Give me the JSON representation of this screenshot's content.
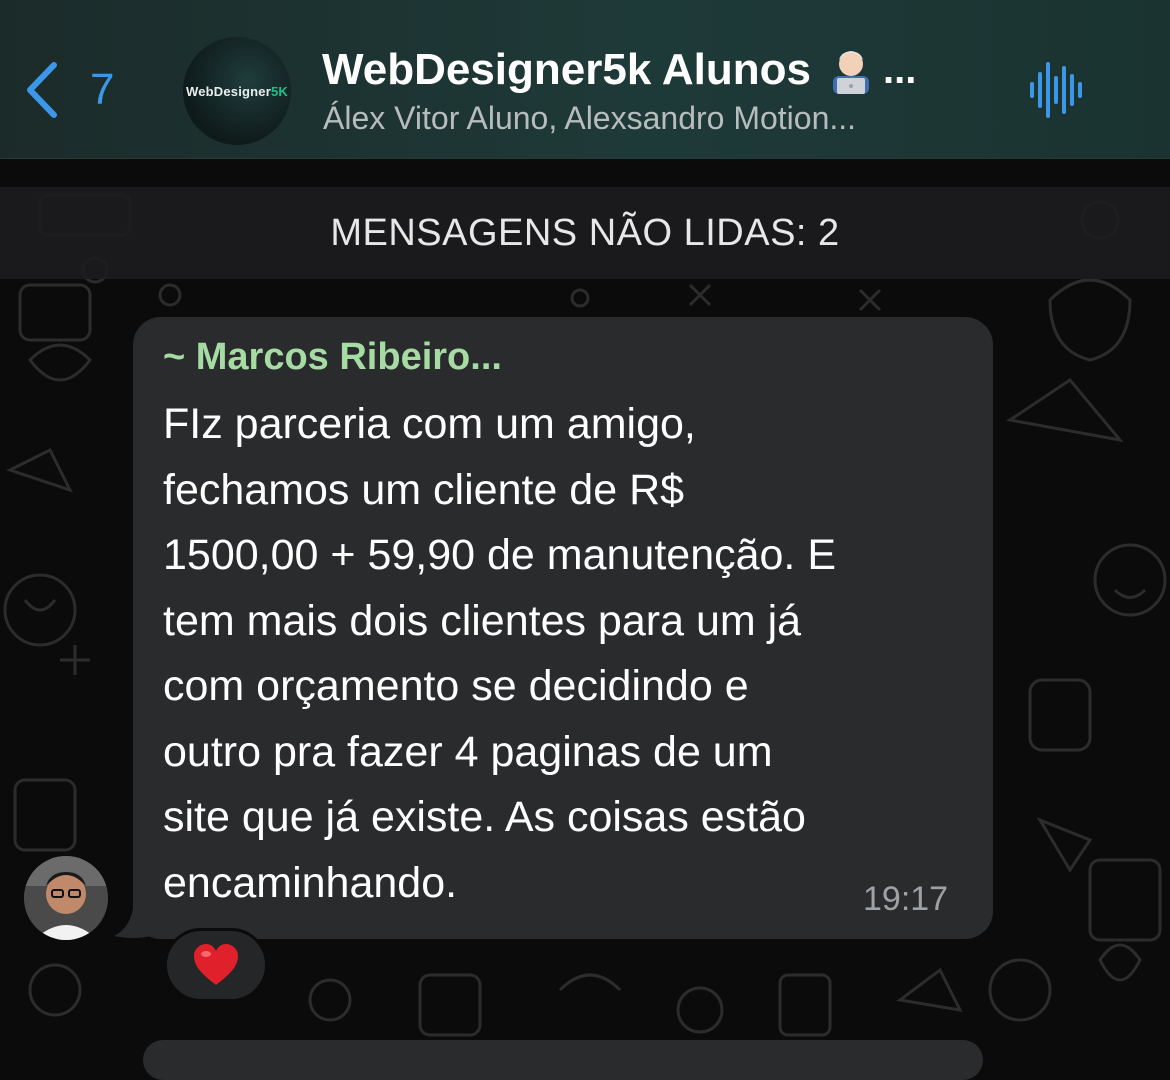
{
  "header": {
    "back_count": "7",
    "avatar_brand": "WebDesigner",
    "avatar_brand_suffix": "5K",
    "title": "WebDesigner5k Alunos",
    "title_ellipsis": "...",
    "subtitle": "Álex Vitor Aluno, Alexsandro Motion..."
  },
  "banner": {
    "text": "MENSAGENS NÃO LIDAS: 2"
  },
  "message": {
    "sender": "~ Marcos Ribeiro...",
    "text": "FIz parceria com um amigo,\nfechamos um cliente de R$\n1500,00 + 59,90 de manutenção. E\ntem mais dois clientes para um já\ncom orçamento se decidindo e\noutro pra fazer 4 paginas de um\nsite que já existe. As coisas estão\nencaminhando.",
    "time": "19:17",
    "reaction": "heart"
  },
  "colors": {
    "accent_blue": "#3d97e8",
    "sender_green": "#a6dca3",
    "bubble_bg": "#2a2b2d",
    "heart_red": "#e0202a"
  },
  "icons": [
    "chevron-left-icon",
    "audio-wave-icon",
    "technologist-emoji-icon",
    "heart-icon"
  ]
}
